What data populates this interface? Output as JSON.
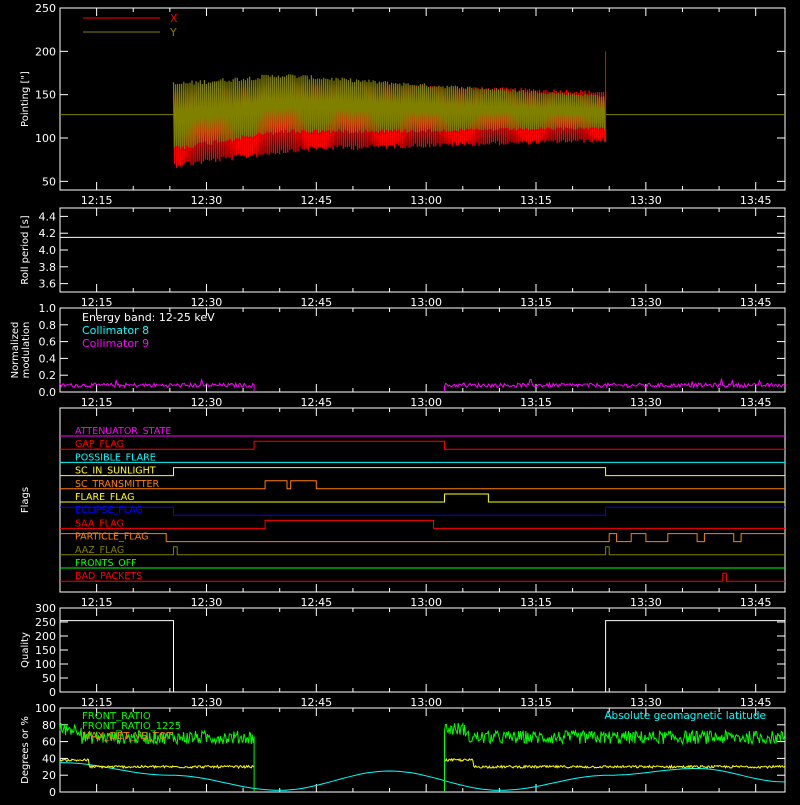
{
  "time_ticks": [
    "12:15",
    "12:30",
    "12:45",
    "13:00",
    "13:15",
    "13:30",
    "13:45"
  ],
  "colors": {
    "background": "#000000",
    "axis": "#ffffff"
  },
  "chart_data": [
    {
      "id": "pointing",
      "type": "line",
      "ylabel": "Pointing [\"]",
      "ylim": [
        40,
        250
      ],
      "yticks": [
        "50",
        "100",
        "150",
        "200",
        "250"
      ],
      "legend_placement": "top-left",
      "series": [
        {
          "name": "X",
          "color": "#ff0000",
          "t_start": "12:25:30",
          "t_end": "13:24:30",
          "center": [
            [
              0,
              110
            ],
            [
              0.3,
              125
            ],
            [
              0.6,
              125
            ],
            [
              1,
              125
            ]
          ],
          "amp_start": 45,
          "amp_end": 30
        },
        {
          "name": "Y",
          "color": "#808000",
          "t_start": "12:25:30",
          "t_end": "13:24:30",
          "center": [
            [
              0,
              125
            ],
            [
              0.25,
              140
            ],
            [
              0.55,
              135
            ],
            [
              1,
              130
            ]
          ],
          "amp_start": 40,
          "amp_end": 20
        },
        {
          "name": "",
          "color": "#808000",
          "constant": 127
        }
      ]
    },
    {
      "id": "roll",
      "type": "line",
      "ylabel": "Roll period [s]",
      "ylim": [
        3.5,
        4.5
      ],
      "yticks": [
        "3.6",
        "3.8",
        "4.0",
        "4.2",
        "4.4"
      ],
      "series": [
        {
          "name": "",
          "color": "#ffffff",
          "values_t": [
            "12:10",
            "13:49"
          ],
          "values_y": [
            4.15,
            4.15
          ]
        }
      ]
    },
    {
      "id": "modulation",
      "type": "line",
      "ylabel_lines": [
        "Normalized",
        "modulation"
      ],
      "ylim": [
        0,
        1.0
      ],
      "yticks": [
        "0.0",
        "0.2",
        "0.4",
        "0.6",
        "0.8",
        "1.0"
      ],
      "legend_placement": "top-left",
      "legend": [
        {
          "text": "Energy band: 12-25 keV",
          "color": "#ffffff"
        },
        {
          "text": "Collimator 8",
          "color": "#00ffff"
        },
        {
          "text": "Collimator 9",
          "color": "#ff00ff"
        }
      ],
      "segments": [
        [
          "12:10",
          "12:36:30"
        ],
        [
          "13:02:30",
          "13:49"
        ]
      ],
      "level": 0.08
    },
    {
      "id": "flags",
      "type": "line",
      "ylabel": "Flags",
      "flags": [
        {
          "name": "ATTENUATOR_STATE",
          "color": "#ff00ff",
          "high": []
        },
        {
          "name": "GAP_FLAG",
          "color": "#ff0000",
          "high": [
            [
              "12:36:30",
              "13:02:30"
            ]
          ]
        },
        {
          "name": "POSSIBLE_FLARE",
          "color": "#00ffff",
          "high": []
        },
        {
          "name": "SC_IN_SUNLIGHT",
          "color": "#ffff00",
          "high": [
            [
              "12:25:30",
              "13:24:30"
            ]
          ]
        },
        {
          "name": "SC_TRANSMITTER",
          "color": "#ff8000",
          "high": [
            [
              "12:38",
              "12:41"
            ],
            [
              "12:41:30",
              "12:45"
            ]
          ]
        },
        {
          "name": "FLARE_FLAG",
          "color": "#ffff00",
          "high": [
            [
              "13:02:30",
              "13:08:30"
            ]
          ]
        },
        {
          "name": "ECLIPSE_FLAG",
          "color": "#0000ff",
          "high": [
            [
              "12:10",
              "12:25:30"
            ],
            [
              "13:24:30",
              "13:49"
            ]
          ]
        },
        {
          "name": "SAA_FLAG",
          "color": "#ff0000",
          "high": [
            [
              "12:38",
              "13:01"
            ]
          ]
        },
        {
          "name": "PARTICLE_FLAG",
          "color": "#ff8000",
          "high": [
            [
              "12:10",
              "12:24:30"
            ],
            [
              "13:25",
              "13:26"
            ],
            [
              "13:28",
              "13:30"
            ],
            [
              "13:33",
              "13:37"
            ],
            [
              "13:38",
              "13:42"
            ],
            [
              "13:43",
              "13:49"
            ]
          ]
        },
        {
          "name": "AAZ_FLAG",
          "color": "#808000",
          "high": [
            [
              "12:25:30",
              "12:26"
            ],
            [
              "13:24:30",
              "13:25"
            ]
          ]
        },
        {
          "name": "FRONTS_OFF",
          "color": "#00ff00",
          "high": []
        },
        {
          "name": "BAD_PACKETS",
          "color": "#ff0000",
          "high": [
            [
              "13:40:30",
              "13:41"
            ]
          ]
        }
      ]
    },
    {
      "id": "quality",
      "type": "line",
      "ylabel": "Quality",
      "ylim": [
        0,
        300
      ],
      "yticks": [
        "0",
        "50",
        "100",
        "150",
        "200",
        "250",
        "300"
      ],
      "series": [
        {
          "name": "",
          "color": "#ffffff",
          "values_t": [
            "12:10",
            "12:25:30",
            "12:25:30",
            "13:24:30",
            "13:24:30",
            "13:49"
          ],
          "values_y": [
            255,
            255,
            0,
            0,
            255,
            255
          ]
        }
      ]
    },
    {
      "id": "ratios",
      "type": "line",
      "ylabel": "Degrees or %",
      "ylim": [
        0,
        100
      ],
      "yticks": [
        "0",
        "20",
        "40",
        "60",
        "80",
        "100"
      ],
      "legend_placement": "top-left",
      "legend": [
        {
          "text": "FRONT_RATIO",
          "color": "#00ff00"
        },
        {
          "text": "FRONT_RATIO_1225",
          "color": "#00ff00"
        },
        {
          "text": "MAX_DET_VS_TOT",
          "color": "#ff8000"
        }
      ],
      "right_label": {
        "text": "Absolute geomagnetic latitude",
        "color": "#00ffff"
      },
      "segments": [
        [
          "12:10",
          "12:36:30"
        ],
        [
          "13:02:30",
          "13:49"
        ]
      ],
      "front_level": 65,
      "maxdet_level": 30,
      "latitude": {
        "t": [
          "12:10",
          "12:25",
          "12:40",
          "12:55",
          "13:10",
          "13:25",
          "13:37",
          "13:49"
        ],
        "y": [
          35,
          20,
          2,
          25,
          2,
          20,
          28,
          12
        ]
      }
    }
  ]
}
